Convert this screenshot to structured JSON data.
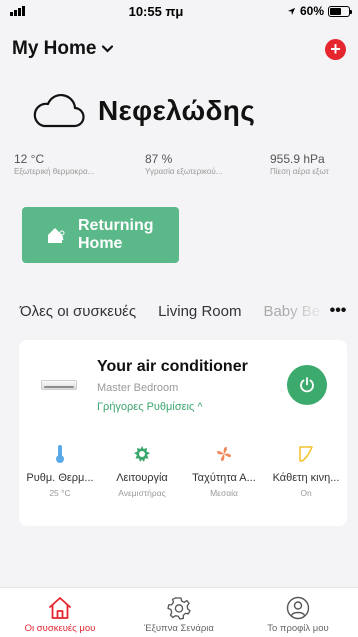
{
  "status_bar": {
    "time": "10:55 πμ",
    "battery": "60%",
    "battery_level": 0.6
  },
  "header": {
    "home_title": "My Home"
  },
  "weather": {
    "condition": "Νεφελώδης",
    "stats": [
      {
        "value": "12 °C",
        "label": "Εξωτερική θερμοκρα..."
      },
      {
        "value": "87 %",
        "label": "Υγρασία εξωτερικού..."
      },
      {
        "value": "955.9 hPa",
        "label": "Πίεση αέρα εξωτ"
      }
    ]
  },
  "scene": {
    "label": "Returning\nHome"
  },
  "tabs": [
    "Όλες οι συσκευές",
    "Living Room",
    "Baby Be"
  ],
  "device": {
    "name": "Your air conditioner",
    "room": "Master Bedroom",
    "quick_settings": "Γρήγορες Ρυθμίσεις ^",
    "controls": [
      {
        "label": "Ρυθμ. Θερμ...",
        "value": "25 °C",
        "icon": "thermometer-icon",
        "color": "#5aa9e6"
      },
      {
        "label": "Λειτουργία",
        "value": "Ανεμιστήρας",
        "icon": "fan-mode-icon",
        "color": "#3aa66c"
      },
      {
        "label": "Ταχύτητα Α...",
        "value": "Μεσαία",
        "icon": "fan-speed-icon",
        "color": "#f08a5d"
      },
      {
        "label": "Κάθετη κινη...",
        "value": "On",
        "icon": "swing-icon",
        "color": "#f4c430"
      }
    ]
  },
  "bottom_nav": [
    {
      "label": "Οι συσκευές μου",
      "icon": "home-icon",
      "active": true
    },
    {
      "label": "Έξυπνα Σενάρια",
      "icon": "gear-icon",
      "active": false
    },
    {
      "label": "Το προφίλ μου",
      "icon": "profile-icon",
      "active": false
    }
  ],
  "colors": {
    "accent_red": "#e5262f",
    "accent_green": "#3daa6d",
    "scene_green": "#5ab889"
  }
}
